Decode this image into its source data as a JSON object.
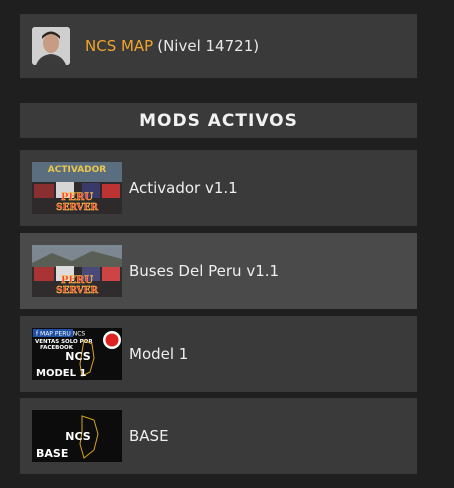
{
  "profile": {
    "name": "NCS MAP",
    "level": "(Nivel 14721)"
  },
  "section": {
    "title": "MODS ACTIVOS"
  },
  "mods": [
    {
      "label": "Activador v1.1",
      "thumb": "peru-server-thumbnail",
      "selected": false
    },
    {
      "label": "Buses Del Peru v1.1",
      "thumb": "peru-server-thumbnail",
      "selected": true
    },
    {
      "label": "Model 1",
      "thumb": "ncs-model1-thumbnail",
      "selected": false
    },
    {
      "label": "BASE",
      "thumb": "ncs-base-thumbnail",
      "selected": false
    }
  ],
  "colors": {
    "accent": "#f0a52a",
    "panel": "#3a3a3a",
    "panel_selected": "#4a4a4a",
    "background": "#1f1f1f"
  }
}
